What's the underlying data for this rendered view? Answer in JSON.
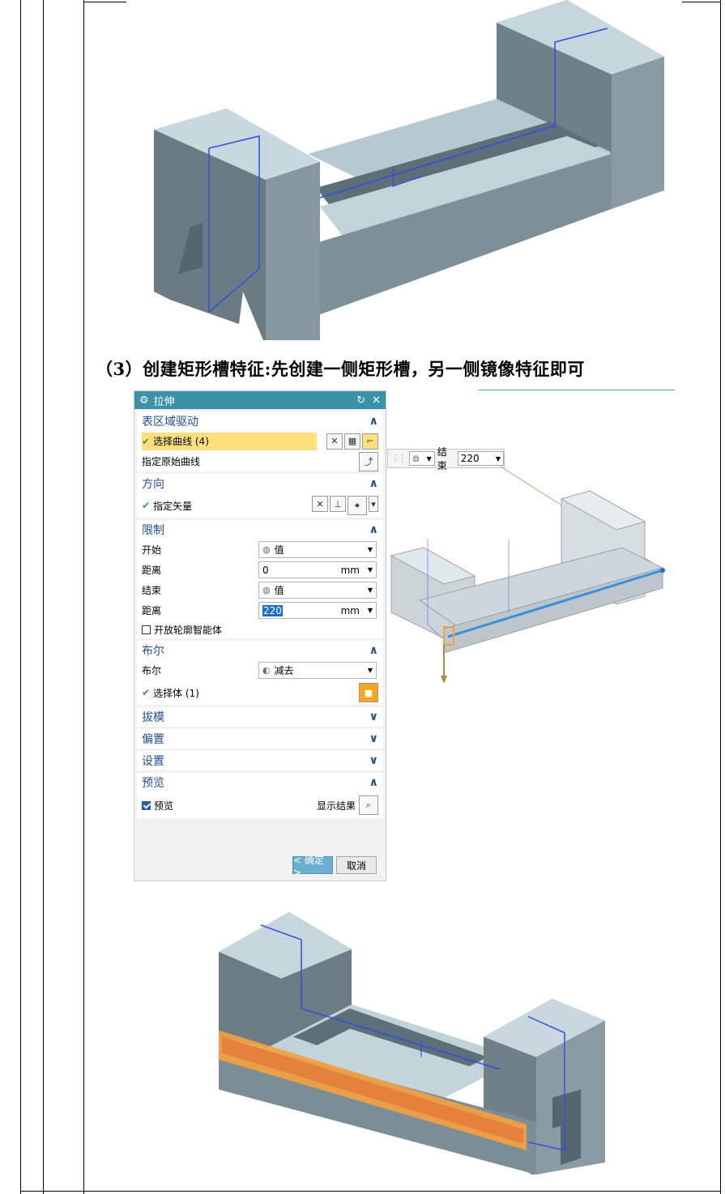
{
  "caption": "（3）创建矩形槽特征:先创建一侧矩形槽，另一侧镜像特征即可",
  "dialog": {
    "title": "拉伸",
    "sections": {
      "surface": {
        "title": "表区域驱动",
        "select_curve": "选择曲线 (4)",
        "specify_curve": "指定原始曲线"
      },
      "direction": {
        "title": "方向",
        "specify_vector": "指定矢量"
      },
      "limits": {
        "title": "限制",
        "start_label": "开始",
        "start_value": "值",
        "dist1_label": "距离",
        "dist1_value": "0",
        "dist1_unit": "mm",
        "end_label": "结束",
        "end_value": "值",
        "dist2_label": "距离",
        "dist2_value": "220",
        "dist2_unit": "mm",
        "open_profile": "开放轮廓智能体"
      },
      "boolean": {
        "title": "布尔",
        "bool_label": "布尔",
        "bool_value": "减去",
        "select_body": "选择体 (1)"
      },
      "draft": {
        "title": "拔模"
      },
      "offset": {
        "title": "偏置"
      },
      "settings": {
        "title": "设置"
      },
      "preview": {
        "title": "预览",
        "preview_label": "预览",
        "show_result": "显示结果"
      }
    },
    "ok": "< 确定 >",
    "cancel": "取消"
  },
  "float_toolbar": {
    "end_label": "结束",
    "end_value": "220"
  },
  "colors": {
    "title_bar": "#3b92a8",
    "section_text": "#1f4e96",
    "highlight": "#fde07c",
    "model_face": "#7b8d96",
    "model_top": "#c5d6de",
    "sketch_line": "#2f4fe6",
    "selected_edge": "#f5a13c"
  }
}
